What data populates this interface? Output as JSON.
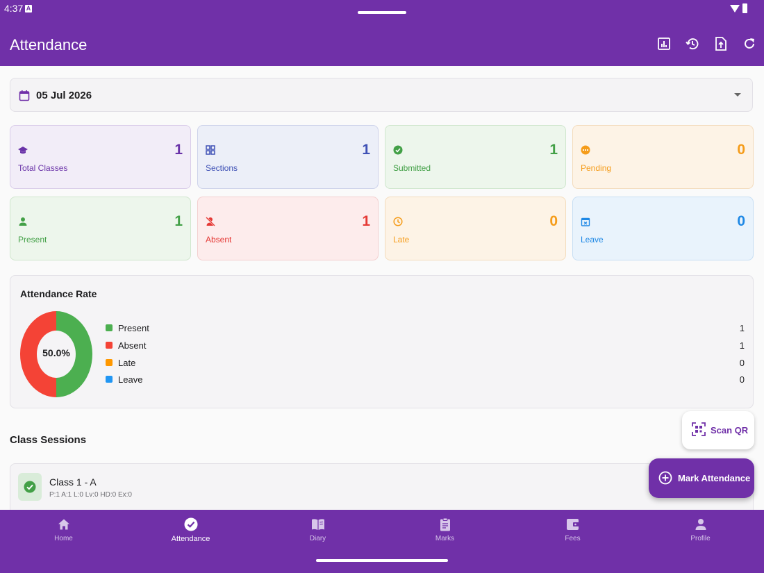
{
  "status_bar": {
    "time": "4:37"
  },
  "app_bar": {
    "title": "Attendance",
    "actions": [
      {
        "icon": "report-icon"
      },
      {
        "icon": "history-icon"
      },
      {
        "icon": "upload-file-icon"
      },
      {
        "icon": "refresh-icon"
      }
    ]
  },
  "date_picker": {
    "value": "05 Jul 2026",
    "icon": "calendar-icon"
  },
  "stats": {
    "total_classes": {
      "label": "Total Classes",
      "value": "1",
      "color": "#6a33a8",
      "icon": "school-icon"
    },
    "sections": {
      "label": "Sections",
      "value": "1",
      "color": "#3f51b5",
      "icon": "grid-icon"
    },
    "submitted": {
      "label": "Submitted",
      "value": "1",
      "color": "#43a047",
      "icon": "check-circle-icon"
    },
    "pending": {
      "label": "Pending",
      "value": "0",
      "color": "#f59c1a",
      "icon": "pending-icon"
    },
    "present": {
      "label": "Present",
      "value": "1",
      "color": "#43a047",
      "icon": "person-icon"
    },
    "absent": {
      "label": "Absent",
      "value": "1",
      "color": "#e53935",
      "icon": "person-off-icon"
    },
    "late": {
      "label": "Late",
      "value": "0",
      "color": "#f59c1a",
      "icon": "clock-icon"
    },
    "leave": {
      "label": "Leave",
      "value": "0",
      "color": "#1e88e5",
      "icon": "event-busy-icon"
    }
  },
  "attendance_rate": {
    "title": "Attendance Rate",
    "percent_label": "50.0%",
    "legend": [
      {
        "label": "Present",
        "value": "1",
        "color": "#4caf50"
      },
      {
        "label": "Absent",
        "value": "1",
        "color": "#f44336"
      },
      {
        "label": "Late",
        "value": "0",
        "color": "#ff9800"
      },
      {
        "label": "Leave",
        "value": "0",
        "color": "#2196f3"
      }
    ]
  },
  "class_sessions": {
    "title": "Class Sessions",
    "sessions": [
      {
        "name": "Class 1 - A",
        "stats": "P:1  A:1  L:0  Lv:0  HD:0  Ex:0",
        "status": "submitted"
      }
    ]
  },
  "scan_qr": {
    "label": "Scan QR",
    "icon": "qr-scan-icon"
  },
  "fab": {
    "label": "Mark Attendance",
    "icon": "add-circle-icon"
  },
  "bottom_nav": {
    "items": [
      {
        "label": "Home",
        "icon": "home-icon",
        "active": false
      },
      {
        "label": "Attendance",
        "icon": "check-circle-icon",
        "active": true
      },
      {
        "label": "Diary",
        "icon": "book-icon",
        "active": false
      },
      {
        "label": "Marks",
        "icon": "clipboard-icon",
        "active": false
      },
      {
        "label": "Fees",
        "icon": "wallet-icon",
        "active": false
      },
      {
        "label": "Profile",
        "icon": "person-icon",
        "active": false
      }
    ]
  },
  "colors": {
    "primary": "#7030a8",
    "present": "#4caf50",
    "absent": "#f44336",
    "late": "#ff9800",
    "leave": "#2196f3"
  }
}
